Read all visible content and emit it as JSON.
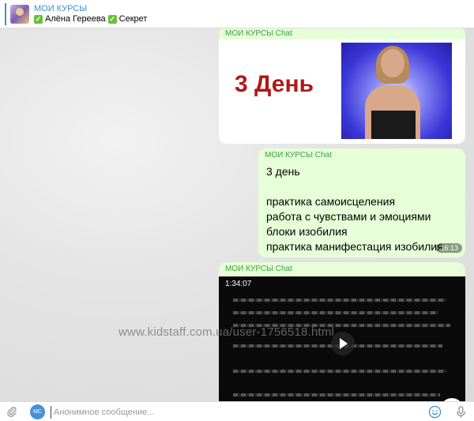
{
  "pinned": {
    "title": "МОИ КУРСЫ",
    "subtitle_name": "Алёна Гереева",
    "subtitle_secret": "Секрет"
  },
  "messages": [
    {
      "sender": "МОИ КУРСЫ Chat",
      "card_text": "3 День"
    },
    {
      "sender": "МОИ КУРСЫ Chat",
      "text": "3 день\n\nпрактика самоисцеления\nработа с чувствами и эмоциями\nблоки изобилия\nпрактика манифестация изобилия",
      "time": "16:13"
    },
    {
      "sender": "МОИ КУРСЫ Chat",
      "video_duration": "1:34:07"
    }
  ],
  "watermark": "www.kidstaff.com.ua/user-1756518.html",
  "composer": {
    "avatar_initials": "MC",
    "placeholder": "Анонимное сообщение..."
  },
  "icons": [
    "paperclip-icon",
    "smile-icon",
    "microphone-icon",
    "chevron-down-icon",
    "play-icon",
    "check-icon"
  ],
  "colors": {
    "accent": "#3a8fd6",
    "sender": "#3ca33a",
    "bubble": "#e6ffd8",
    "day_text": "#b01818"
  }
}
